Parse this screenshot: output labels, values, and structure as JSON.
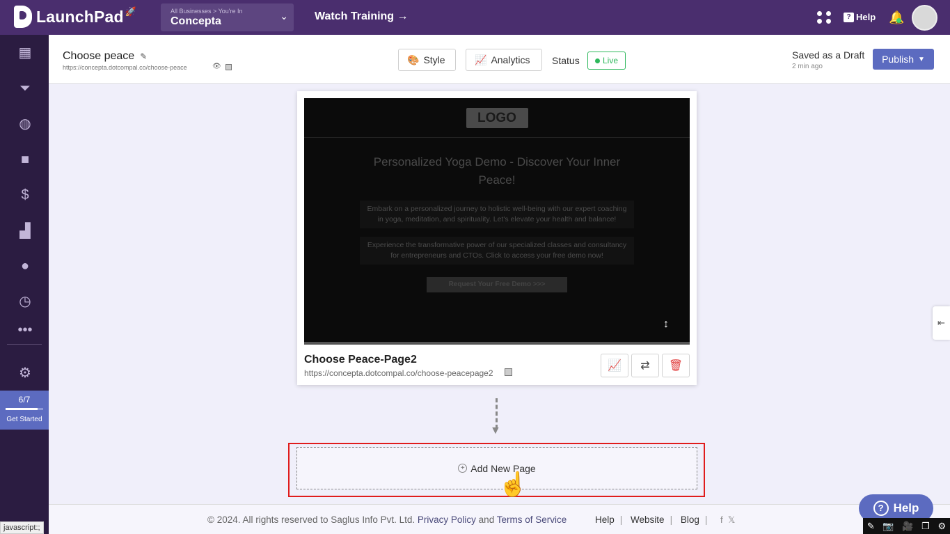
{
  "topbar": {
    "app_name": "LaunchPad",
    "business_crumb": "All Businesses > You're In",
    "business_name": "Concepta",
    "watch_training": "Watch Training →",
    "help_label": "Help"
  },
  "sidebar": {
    "items": [
      "dashboard-icon",
      "funnel-icon",
      "globe-icon",
      "video-icon",
      "dollar-icon",
      "analytics-icon",
      "users-icon",
      "gauge-icon",
      "more-icon",
      "settings-icon"
    ],
    "progress_ratio": "6/7",
    "progress_fraction": 0.86,
    "progress_label": "Get Started"
  },
  "header": {
    "page_name": "Choose peace",
    "page_url": "https://concepta.dotcompal.co/choose-peace",
    "style_label": "Style",
    "analytics_label": "Analytics",
    "status_label": "Status",
    "status_value": "Live",
    "saved_label": "Saved as a Draft",
    "saved_time": "2 min ago",
    "publish_label": "Publish"
  },
  "preview": {
    "logo_text": "LOGO",
    "title": "Personalized Yoga Demo - Discover Your Inner Peace!",
    "paragraph1": "Embark on a personalized journey to holistic well-being with our expert coaching in yoga, meditation, and spirituality. Let's elevate your health and balance!",
    "paragraph2": "Experience the transformative power of our specialized classes and consultancy for entrepreneurs and CTOs. Click to access your free demo now!",
    "cta_label": "Request Your Free Demo >>>"
  },
  "card": {
    "title": "Choose Peace-Page2",
    "url": "https://concepta.dotcompal.co/choose-peacepage2"
  },
  "add_page_label": "Add New Page",
  "footer": {
    "copyright": "©  2024. All rights reserved to Saglus Info Pvt. Ltd.",
    "privacy": "Privacy Policy",
    "and": "and",
    "terms": "Terms of Service",
    "help": "Help",
    "website": "Website",
    "blog": "Blog"
  },
  "help_float_label": "Help",
  "status_bar_text": "javascript:;"
}
